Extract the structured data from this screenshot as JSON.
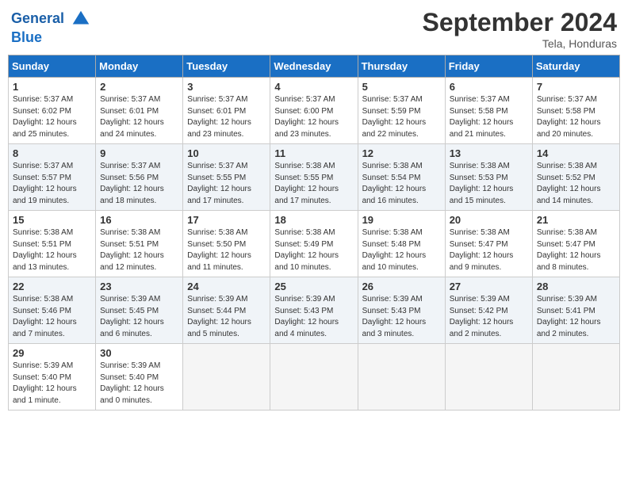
{
  "header": {
    "logo_line1": "General",
    "logo_line2": "Blue",
    "month": "September 2024",
    "location": "Tela, Honduras"
  },
  "days_of_week": [
    "Sunday",
    "Monday",
    "Tuesday",
    "Wednesday",
    "Thursday",
    "Friday",
    "Saturday"
  ],
  "weeks": [
    [
      {
        "num": "1",
        "rise": "5:37 AM",
        "set": "6:02 PM",
        "hours": "12 hours and 25 minutes."
      },
      {
        "num": "2",
        "rise": "5:37 AM",
        "set": "6:01 PM",
        "hours": "12 hours and 24 minutes."
      },
      {
        "num": "3",
        "rise": "5:37 AM",
        "set": "6:01 PM",
        "hours": "12 hours and 23 minutes."
      },
      {
        "num": "4",
        "rise": "5:37 AM",
        "set": "6:00 PM",
        "hours": "12 hours and 23 minutes."
      },
      {
        "num": "5",
        "rise": "5:37 AM",
        "set": "5:59 PM",
        "hours": "12 hours and 22 minutes."
      },
      {
        "num": "6",
        "rise": "5:37 AM",
        "set": "5:58 PM",
        "hours": "12 hours and 21 minutes."
      },
      {
        "num": "7",
        "rise": "5:37 AM",
        "set": "5:58 PM",
        "hours": "12 hours and 20 minutes."
      }
    ],
    [
      {
        "num": "8",
        "rise": "5:37 AM",
        "set": "5:57 PM",
        "hours": "12 hours and 19 minutes."
      },
      {
        "num": "9",
        "rise": "5:37 AM",
        "set": "5:56 PM",
        "hours": "12 hours and 18 minutes."
      },
      {
        "num": "10",
        "rise": "5:37 AM",
        "set": "5:55 PM",
        "hours": "12 hours and 17 minutes."
      },
      {
        "num": "11",
        "rise": "5:38 AM",
        "set": "5:55 PM",
        "hours": "12 hours and 17 minutes."
      },
      {
        "num": "12",
        "rise": "5:38 AM",
        "set": "5:54 PM",
        "hours": "12 hours and 16 minutes."
      },
      {
        "num": "13",
        "rise": "5:38 AM",
        "set": "5:53 PM",
        "hours": "12 hours and 15 minutes."
      },
      {
        "num": "14",
        "rise": "5:38 AM",
        "set": "5:52 PM",
        "hours": "12 hours and 14 minutes."
      }
    ],
    [
      {
        "num": "15",
        "rise": "5:38 AM",
        "set": "5:51 PM",
        "hours": "12 hours and 13 minutes."
      },
      {
        "num": "16",
        "rise": "5:38 AM",
        "set": "5:51 PM",
        "hours": "12 hours and 12 minutes."
      },
      {
        "num": "17",
        "rise": "5:38 AM",
        "set": "5:50 PM",
        "hours": "12 hours and 11 minutes."
      },
      {
        "num": "18",
        "rise": "5:38 AM",
        "set": "5:49 PM",
        "hours": "12 hours and 10 minutes."
      },
      {
        "num": "19",
        "rise": "5:38 AM",
        "set": "5:48 PM",
        "hours": "12 hours and 10 minutes."
      },
      {
        "num": "20",
        "rise": "5:38 AM",
        "set": "5:47 PM",
        "hours": "12 hours and 9 minutes."
      },
      {
        "num": "21",
        "rise": "5:38 AM",
        "set": "5:47 PM",
        "hours": "12 hours and 8 minutes."
      }
    ],
    [
      {
        "num": "22",
        "rise": "5:38 AM",
        "set": "5:46 PM",
        "hours": "12 hours and 7 minutes."
      },
      {
        "num": "23",
        "rise": "5:39 AM",
        "set": "5:45 PM",
        "hours": "12 hours and 6 minutes."
      },
      {
        "num": "24",
        "rise": "5:39 AM",
        "set": "5:44 PM",
        "hours": "12 hours and 5 minutes."
      },
      {
        "num": "25",
        "rise": "5:39 AM",
        "set": "5:43 PM",
        "hours": "12 hours and 4 minutes."
      },
      {
        "num": "26",
        "rise": "5:39 AM",
        "set": "5:43 PM",
        "hours": "12 hours and 3 minutes."
      },
      {
        "num": "27",
        "rise": "5:39 AM",
        "set": "5:42 PM",
        "hours": "12 hours and 2 minutes."
      },
      {
        "num": "28",
        "rise": "5:39 AM",
        "set": "5:41 PM",
        "hours": "12 hours and 2 minutes."
      }
    ],
    [
      {
        "num": "29",
        "rise": "5:39 AM",
        "set": "5:40 PM",
        "hours": "12 hours and 1 minute."
      },
      {
        "num": "30",
        "rise": "5:39 AM",
        "set": "5:40 PM",
        "hours": "12 hours and 0 minutes."
      },
      null,
      null,
      null,
      null,
      null
    ]
  ]
}
